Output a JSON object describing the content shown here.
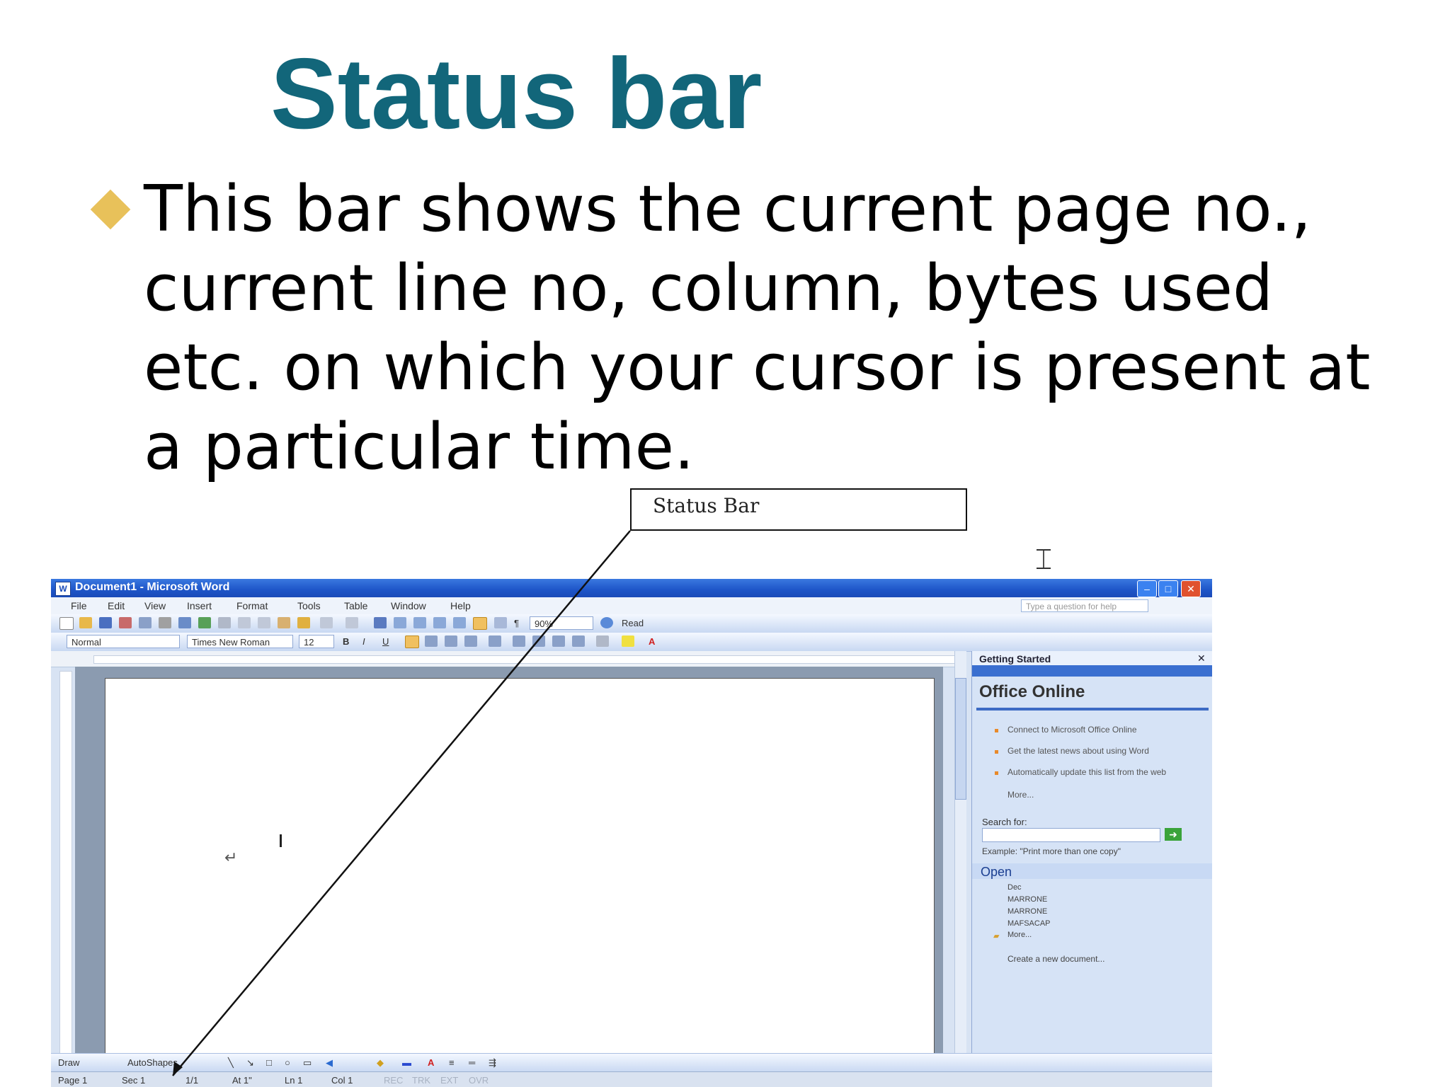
{
  "slide": {
    "title": "Status bar",
    "bullet": "This bar shows the current page no., current line no, column, bytes used etc. on which your cursor is present at a particular time.",
    "callout": "Status Bar"
  },
  "window": {
    "title": "Document1 - Microsoft Word",
    "menu": [
      "File",
      "Edit",
      "View",
      "Insert",
      "Format",
      "Tools",
      "Table",
      "Window",
      "Help"
    ],
    "help_placeholder": "Type a question for help",
    "zoom": "90%",
    "read_label": "Read",
    "style": "Normal",
    "font": "Times New Roman",
    "font_size": "12",
    "draw_label": "Draw",
    "autoshapes_label": "AutoShapes"
  },
  "taskpane": {
    "title": "Getting Started",
    "office_online": "Office Online",
    "links": [
      "Connect to Microsoft Office Online",
      "Get the latest news about using Word",
      "Automatically update this list from the web"
    ],
    "more": "More...",
    "search_label": "Search for:",
    "example": "Example: \"Print more than one copy\"",
    "open_title": "Open",
    "files": [
      "Dec",
      "MARRONE",
      "MARRONE",
      "MAFSACAP"
    ],
    "files_more": "More...",
    "create_new": "Create a new document..."
  },
  "statusbar": {
    "page": "Page 1",
    "sec": "Sec 1",
    "pages": "1/1",
    "at": "At 1\"",
    "ln": "Ln 1",
    "col": "Col 1",
    "rec": "REC",
    "trk": "TRK",
    "ext": "EXT",
    "ovr": "OVR"
  },
  "colors": {
    "title": "#12667a",
    "bullet": "#e8c15a",
    "titlebar": "#1e55c8"
  }
}
